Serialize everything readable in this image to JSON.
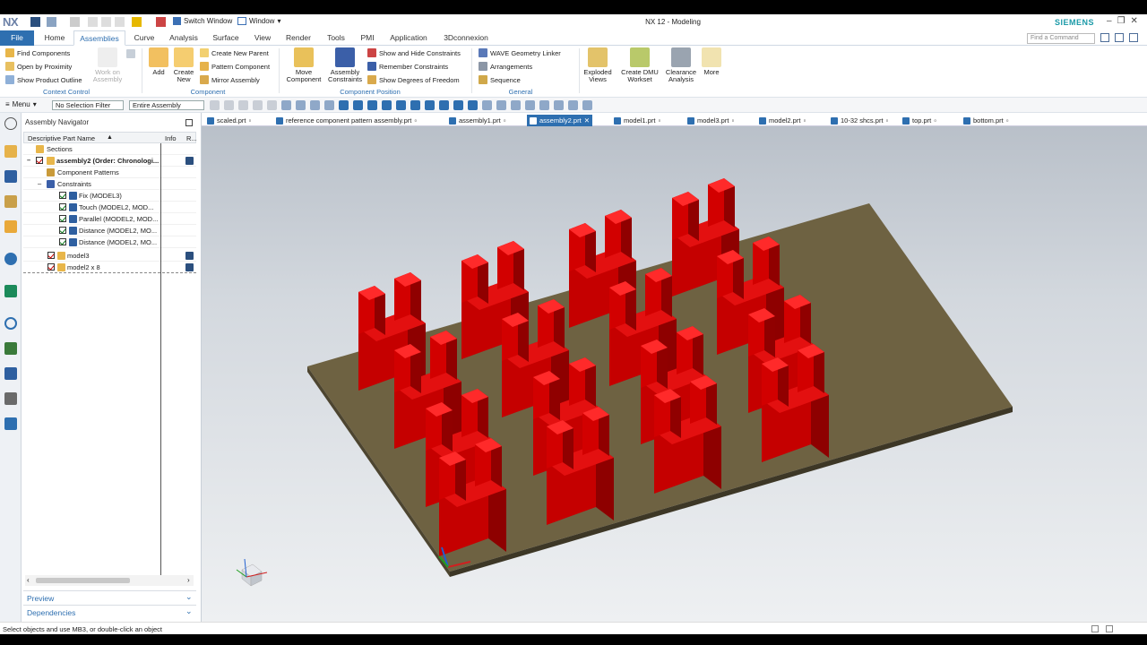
{
  "app": {
    "logo": "NX",
    "title": "NX 12 - Modeling",
    "brand": "SIEMENS"
  },
  "titlebar": {
    "switch_window": "Switch Window",
    "window_menu": "Window"
  },
  "menu_tabs": [
    "File",
    "Home",
    "Assemblies",
    "Curve",
    "Analysis",
    "Surface",
    "View",
    "Render",
    "Tools",
    "PMI",
    "Application",
    "3Dconnexion"
  ],
  "active_tab": "Assemblies",
  "search": {
    "placeholder": "Find a Command"
  },
  "ribbon": {
    "context_control": {
      "find_components": "Find Components",
      "open_by_proximity": "Open by Proximity",
      "show_product_outline": "Show Product Outline",
      "work_on_assembly_1": "Work on",
      "work_on_assembly_2": "Assembly",
      "label": "Context Control"
    },
    "component": {
      "add": "Add",
      "create_new_1": "Create",
      "create_new_2": "New",
      "create_new_parent": "Create New Parent",
      "pattern_component": "Pattern Component",
      "mirror_assembly": "Mirror Assembly",
      "label": "Component"
    },
    "component_position": {
      "move_component_1": "Move",
      "move_component_2": "Component",
      "assembly_constraints_1": "Assembly",
      "assembly_constraints_2": "Constraints",
      "show_hide_constraints": "Show and Hide Constraints",
      "remember_constraints": "Remember Constraints",
      "show_degrees_of_freedom": "Show Degrees of Freedom",
      "label": "Component Position"
    },
    "general": {
      "wave_geometry_linker": "WAVE Geometry Linker",
      "arrangements": "Arrangements",
      "sequence": "Sequence",
      "label": "General"
    },
    "exploded_views_1": "Exploded",
    "exploded_views_2": "Views",
    "create_dmu_1": "Create DMU",
    "create_dmu_2": "Workset",
    "clearance_1": "Clearance",
    "clearance_2": "Analysis",
    "more": "More"
  },
  "toolbar": {
    "menu": "Menu",
    "selection_filter": "No Selection Filter",
    "scope": "Entire Assembly"
  },
  "navigator": {
    "title": "Assembly Navigator",
    "columns": {
      "name": "Descriptive Part Name",
      "info": "Info",
      "r": "R..."
    },
    "rows": {
      "sections": "Sections",
      "assembly": "assembly2 (Order: Chronologi...",
      "component_patterns": "Component Patterns",
      "constraints": "Constraints",
      "fix": "Fix (MODEL3)",
      "touch": "Touch (MODEL2, MOD...",
      "parallel": "Parallel (MODEL2, MOD...",
      "distance1": "Distance (MODEL2, MO...",
      "distance2": "Distance (MODEL2, MO...",
      "model3": "model3",
      "model2": "model2 x 8"
    },
    "preview": "Preview",
    "dependencies": "Dependencies"
  },
  "doc_tabs": [
    "scaled.prt",
    "reference component pattern assembly.prt",
    "assembly1.prt",
    "assembly2.prt",
    "model1.prt",
    "model3.prt",
    "model2.prt",
    "10-32 shcs.prt",
    "top.prt",
    "bottom.prt"
  ],
  "active_doc": "assembly2.prt",
  "status": "Select objects and use MB3, or double-click an object",
  "colors": {
    "accent": "#2e6fb0",
    "part_red": "#d10000",
    "plate": "#6e6242",
    "brand": "#1b9aa8"
  }
}
